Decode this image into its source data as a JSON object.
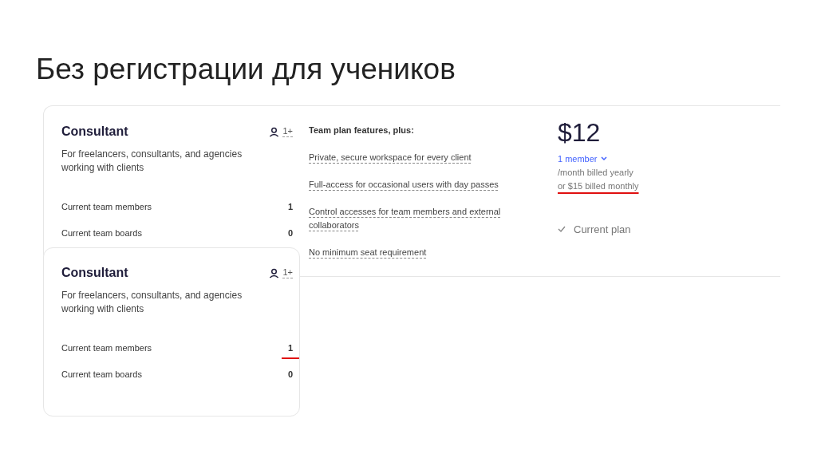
{
  "slide_title": "Без регистрации для учеников",
  "plan_cards": [
    {
      "name": "Consultant",
      "seats": "1+",
      "description": "For freelancers, consultants, and agencies working with clients",
      "stats": [
        {
          "label": "Current team members",
          "value": "1",
          "marked": false
        },
        {
          "label": "Current team boards",
          "value": "0",
          "marked": false
        }
      ]
    },
    {
      "name": "Consultant",
      "seats": "1+",
      "description": "For freelancers, consultants, and agencies working with clients",
      "stats": [
        {
          "label": "Current team members",
          "value": "1",
          "marked": true
        },
        {
          "label": "Current team boards",
          "value": "0",
          "marked": false
        }
      ]
    }
  ],
  "features": {
    "heading": "Team plan features, plus:",
    "items": [
      "Private, secure workspace for every client",
      "Full-access for occasional users with day passes",
      "Control accesses for team members and external collaborators",
      "No minimum seat requirement"
    ]
  },
  "pricing": {
    "price": "$12",
    "member_select": "1 member",
    "billing_yearly": "/month billed yearly",
    "billing_monthly": "or $15 billed monthly",
    "monthly_marked": true,
    "status": "Current plan"
  }
}
